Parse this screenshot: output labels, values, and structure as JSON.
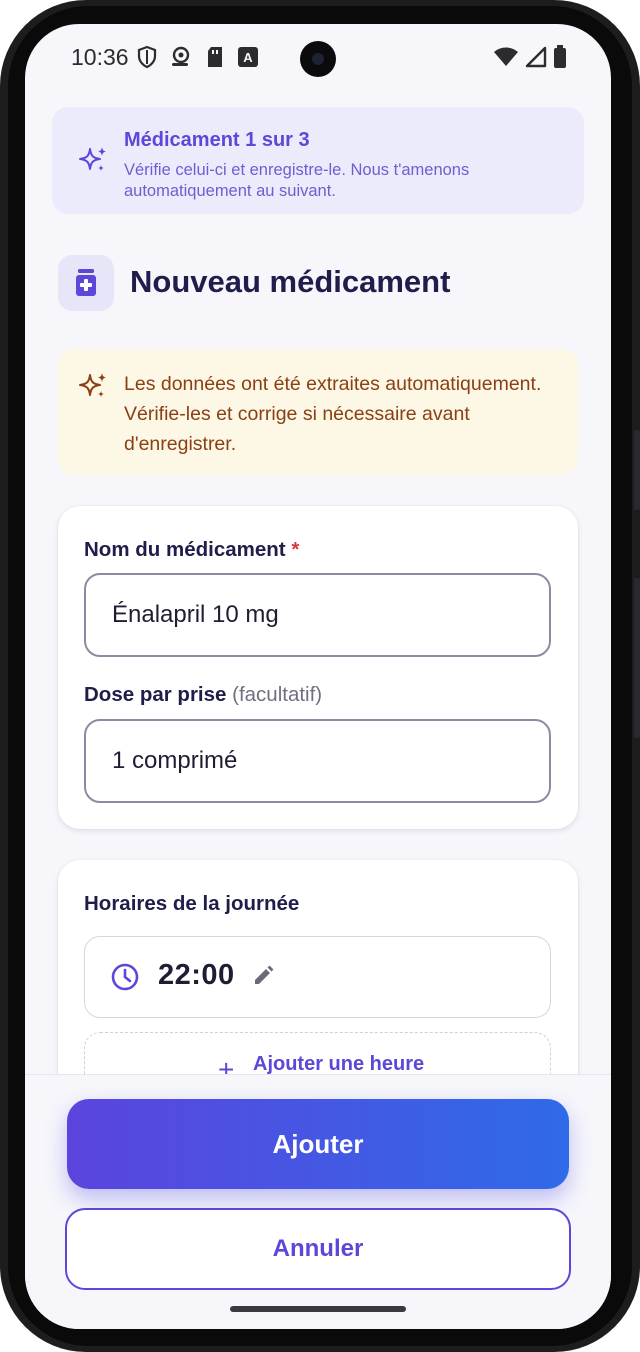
{
  "status_bar": {
    "time": "10:36",
    "icons_left": [
      "shield-icon",
      "location-pin-icon",
      "sd-card-icon",
      "font-icon"
    ],
    "icons_right": [
      "wifi-icon",
      "cellular-signal-icon",
      "battery-icon"
    ]
  },
  "progress_banner": {
    "title": "Médicament 1 sur 3",
    "subtitle": "Vérifie celui-ci et enregistre-le. Nous t'amenons automatiquement au suivant.",
    "icon": "sparkles-icon"
  },
  "header": {
    "title": "Nouveau médicament",
    "icon": "medicine-box-icon"
  },
  "info_banner": {
    "text": "Les données ont été extraites automatiquement. Vérifie-les et corrige si nécessaire avant d'enregistrer.",
    "icon": "sparkles-icon"
  },
  "form": {
    "name_label": "Nom du médicament",
    "name_required_mark": "*",
    "name_value": "Énalapril 10 mg",
    "dose_label": "Dose par prise",
    "dose_optional": "(facultatif)",
    "dose_value": "1 comprimé"
  },
  "schedule": {
    "title": "Horaires de la journée",
    "times": [
      "22:00"
    ],
    "add_time_label": "Ajouter une heure",
    "add_time_icon": "+"
  },
  "actions": {
    "primary_label": "Ajouter",
    "secondary_label": "Annuler"
  },
  "colors": {
    "accent": "#5b48d8",
    "gradient_start": "#5b44dd",
    "gradient_end": "#2f6ae9",
    "warning_bg": "#fdf7e5",
    "warning_text": "#8a3f14",
    "required": "#d23b3b"
  }
}
